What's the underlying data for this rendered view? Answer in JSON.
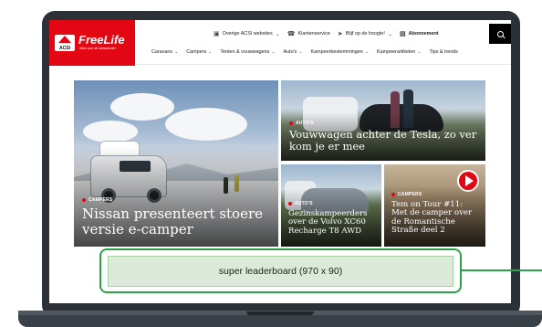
{
  "header": {
    "logo_badge": "ACSI",
    "logo_name": "FreeLife",
    "logo_tagline": "Alles voor de kampeerder",
    "topbar": [
      {
        "icon": "monitor-icon",
        "label": "Overige ACSI websites",
        "has_dropdown": true
      },
      {
        "icon": "headset-icon",
        "label": "Klantenservice",
        "has_dropdown": false
      },
      {
        "icon": "send-icon",
        "label": "Blijf op de hoogte!",
        "has_dropdown": true
      },
      {
        "icon": "book-icon",
        "label": "Abonnement",
        "has_dropdown": false
      }
    ],
    "nav": [
      "Caravans",
      "Campers",
      "Tenten & vouwwagens",
      "Auto's",
      "Kampeerbestemmingen",
      "Kampeerartikelen",
      "Tips & trends"
    ]
  },
  "articles": {
    "hero": {
      "category": "CAMPERS",
      "title": "Nissan presenteert stoere versie e-camper"
    },
    "tesla": {
      "category": "AUTO'S",
      "title": "Vouwwagen achter de Tesla, zo ver kom je er mee"
    },
    "volvo": {
      "category": "AUTO'S",
      "title": "Gezinskampeerders over de Volvo XC60 Recharge T8 AWD"
    },
    "tour": {
      "category": "CAMPERS",
      "title": "Tem on Tour #11: Met de camper over de Romantische Straße deel 2"
    }
  },
  "ad": {
    "label": "super leaderboard (970 x 90)"
  },
  "colors": {
    "brand_red": "#e30613",
    "ad_green": "#2aa34a",
    "ad_fill": "#dcead9",
    "bezel": "#2c3137"
  }
}
